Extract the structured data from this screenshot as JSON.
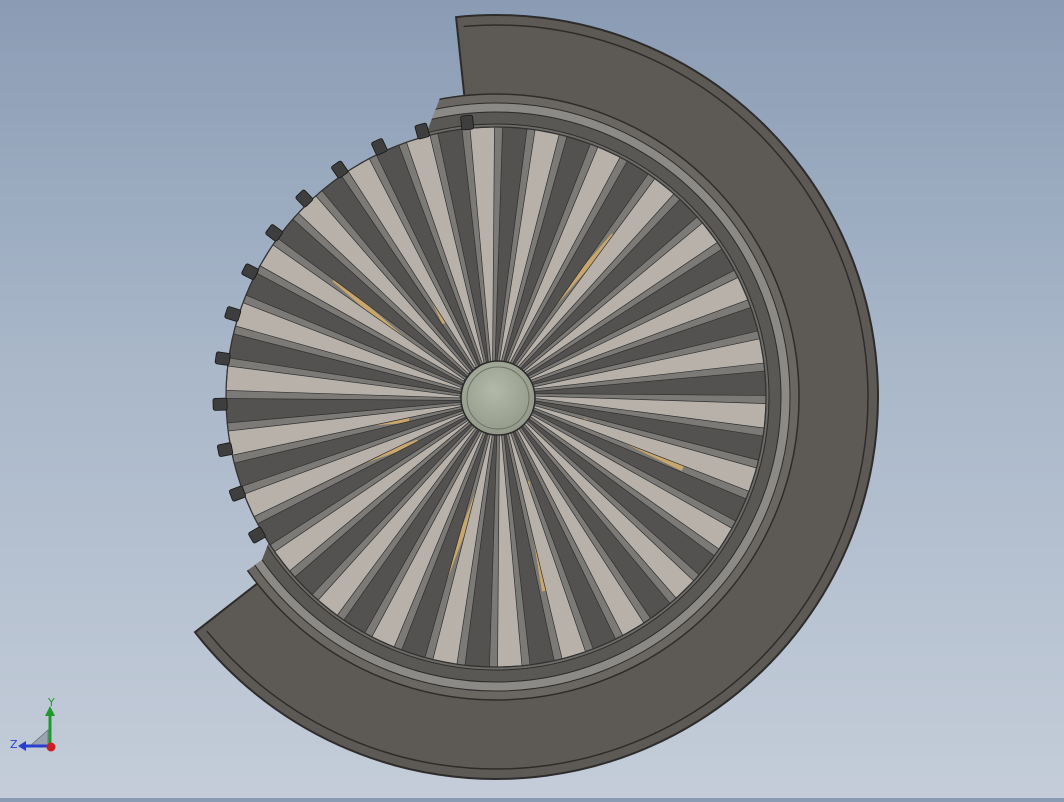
{
  "viewport": {
    "model": "fan-rotor-section-view",
    "background_top": "#8a9cb4",
    "background_bottom": "#c4cdd9"
  },
  "part_colors": {
    "casing": "#5d5a56",
    "casing_edge": "#2e2c2a",
    "ring": "#8c8a86",
    "blade_light": "#b7b1aa",
    "blade_dark": "#545250",
    "inner_blade": "#c9a66b",
    "hub": "#a5ab9b"
  },
  "triad": {
    "y_label": "Y",
    "z_label": "Z",
    "y_color": "#1f9a2a",
    "z_color": "#2a3fd0",
    "x_color": "#cc2020"
  }
}
